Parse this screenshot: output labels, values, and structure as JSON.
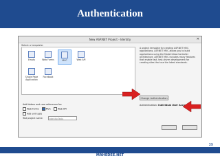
{
  "slide": {
    "title": "Authentication",
    "page_number": "39",
    "footer": "MAHEDEE.NET"
  },
  "dialog": {
    "title": "New ASP.NET Project - Identity",
    "select_template_label": "Select a template:",
    "templates": [
      {
        "label": "Empty"
      },
      {
        "label": "Web Forms"
      },
      {
        "label": "MVC"
      },
      {
        "label": "Web API"
      },
      {
        "label": "Single Page Application"
      },
      {
        "label": "Facebook"
      }
    ],
    "description": "A project template for creating ASP.NET MVC applications. ASP.NET MVC allows you to build applications using the Model-View-Controller architecture. ASP.NET MVC includes many features that enable fast, test-driven development for creating sites that use the latest standards.",
    "change_auth_button": "Change Authentication",
    "auth_label": "Authentication:",
    "auth_value": "Individual User Accounts",
    "add_folders_label": "Add folders and core references for:",
    "check_web_forms": "Web Forms",
    "check_mvc": "MVC",
    "check_web_api": "Web API",
    "check_unit_tests": "Add unit tests",
    "test_project_label": "Test project name:",
    "test_project_value": "Identity.Tests"
  },
  "colors": {
    "brand": "#1f4b8f",
    "arrow": "#d92020"
  }
}
